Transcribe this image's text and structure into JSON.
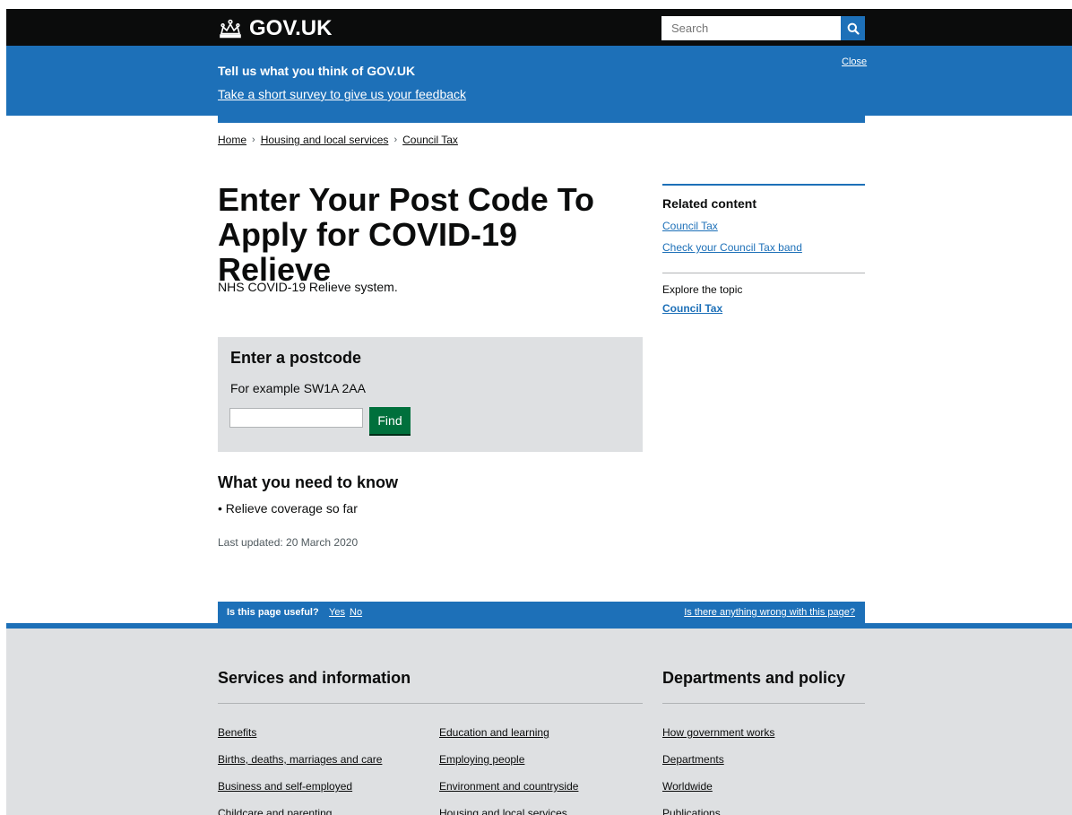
{
  "header": {
    "logo_text": "GOV.UK",
    "search_placeholder": "Search"
  },
  "survey": {
    "title": "Tell us what you think of GOV.UK",
    "link": "Take a short survey to give us your feedback",
    "close": "Close"
  },
  "breadcrumb": [
    "Home",
    "Housing and local services",
    "Council Tax"
  ],
  "main": {
    "title": "Enter Your Post Code To Apply for COVID-19 Relieve",
    "lead": "NHS COVID-19 Relieve system.",
    "postcode": {
      "title": "Enter a postcode",
      "hint": "For example SW1A 2AA",
      "value": "",
      "button": "Find"
    },
    "know_title": "What you need to know",
    "know_items": [
      "Relieve coverage so far"
    ],
    "updated": "Last updated: 20 March 2020"
  },
  "sidebar": {
    "title": "Related content",
    "links": [
      "Council Tax",
      "Check your Council Tax band"
    ],
    "explore": "Explore the topic",
    "topic": "Council Tax"
  },
  "feedback": {
    "question": "Is this page useful?",
    "yes": "Yes",
    "no": "No",
    "wrong": "Is there anything wrong with this page?"
  },
  "footer": {
    "services_title": "Services and information",
    "departments_title": "Departments and policy",
    "col1": [
      "Benefits",
      "Births, deaths, marriages and care",
      "Business and self-employed",
      "Childcare and parenting"
    ],
    "col2": [
      "Education and learning",
      "Employing people",
      "Environment and countryside",
      "Housing and local services"
    ],
    "col3": [
      "How government works",
      "Departments",
      "Worldwide",
      "Publications"
    ]
  },
  "colors": {
    "header_bg": "#0b0c0c",
    "brand_blue": "#1d70b8",
    "button_green": "#00703c",
    "panel_grey": "#dee0e2"
  },
  "icons": [
    "crown-icon",
    "search-icon"
  ]
}
